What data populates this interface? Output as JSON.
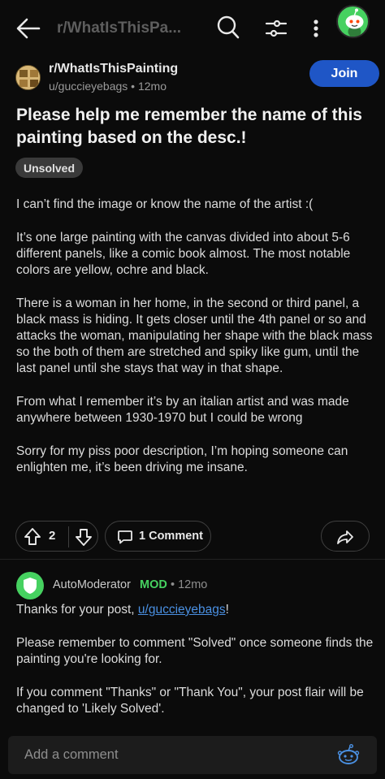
{
  "topbar": {
    "title": "r/WhatIsThisPa..."
  },
  "post": {
    "subreddit": "r/WhatIsThisPainting",
    "meta": "u/guccieyebags • 12mo",
    "join_label": "Join",
    "title": "Please help me remember the name of this painting based on the desc.!",
    "flair": "Unsolved",
    "body": [
      "I can’t find the image or know the name of the artist :(",
      "It’s one large painting with the canvas divided into about 5-6 different panels, like a comic book almost. The most notable colors are yellow, ochre and black.",
      "There is a woman in her home, in the second or third panel, a black mass is hiding. It gets closer until the 4th panel or so and attacks the woman, manipulating her shape with the black mass so the both of them are stretched and spiky like gum, until the last panel until she stays that way in that shape.",
      "From what I remember it’s by an italian artist and was made anywhere between 1930-1970 but I could be wrong",
      "Sorry for my piss poor description, I’m hoping someone can enlighten me, it’s been driving me insane."
    ],
    "vote_count": "2",
    "comment_label": "1 Comment"
  },
  "comment": {
    "author": "AutoModerator",
    "mod_badge": "MOD",
    "time": "• 12mo",
    "line1_prefix": "Thanks for your post, ",
    "line1_link": "u/guccieyebags",
    "line1_suffix": "!",
    "p2": "Please remember to comment \"Solved\" once someone finds the painting you're looking for.",
    "p3": "If you comment \"Thanks\" or \"Thank You\", your post flair will be changed to 'Likely Solved'."
  },
  "composer": {
    "placeholder": "Add a comment"
  },
  "colors": {
    "background": "#0b0b0b",
    "join_button": "#1f56c6",
    "mod_green": "#46d160",
    "link_blue": "#4a90e2"
  }
}
